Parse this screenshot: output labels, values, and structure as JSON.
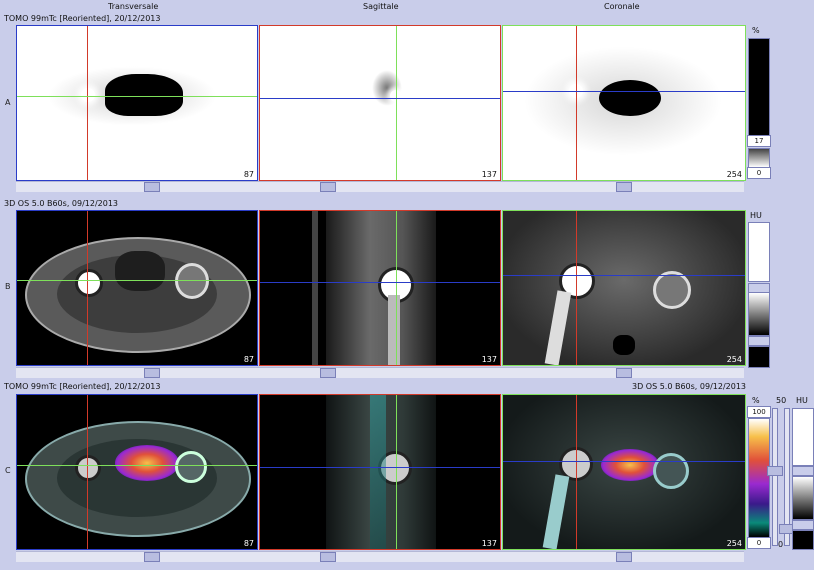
{
  "headers": {
    "transversale": "Transversale",
    "sagittale": "Sagittale",
    "coronale": "Coronale"
  },
  "rows": {
    "a": {
      "label": "A",
      "title": "TOMO 99mTc [Reoriented], 20/12/2013"
    },
    "b": {
      "label": "B",
      "title": "3D  OS  5.0  B60s, 09/12/2013"
    },
    "c": {
      "label": "C",
      "title": "TOMO 99mTc [Reoriented], 20/12/2013",
      "title_right": "3D  OS  5.0  B60s, 09/12/2013"
    }
  },
  "slices": {
    "transversale": "87",
    "sagittale": "137",
    "coronale": "254"
  },
  "scales": {
    "a": {
      "unit": "%",
      "upper": "17",
      "lower": "0"
    },
    "b": {
      "unit": "HU"
    },
    "c": {
      "unit_pct": "%",
      "unit_hu": "HU",
      "pct_max": "100",
      "pct_min": "0",
      "mid": "50",
      "zero": "0"
    }
  },
  "colors": {
    "background": "#c9cdea",
    "red_line": "#d23a2a",
    "green_line": "#7ee05a",
    "blue_line": "#2a3cc8"
  }
}
